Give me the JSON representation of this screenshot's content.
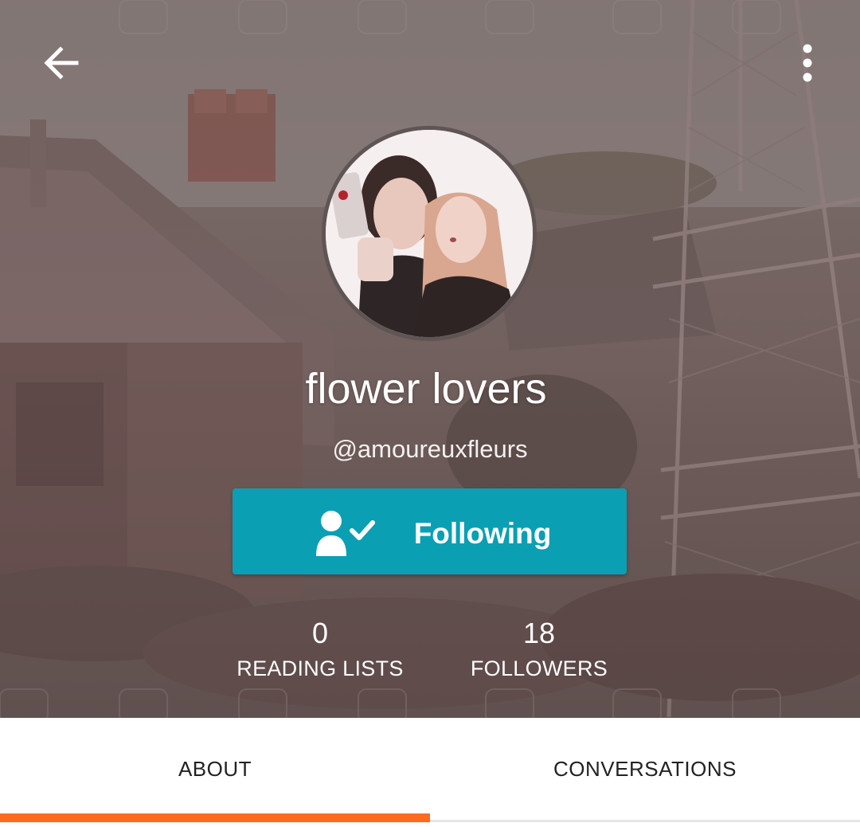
{
  "header": {
    "back_icon": "arrow-left-icon",
    "menu_icon": "more-vertical-icon"
  },
  "profile": {
    "name": "flower lovers",
    "handle": "@amoureuxfleurs",
    "avatar_icon": "profile-photo"
  },
  "follow": {
    "label": "Following",
    "icon": "user-check-icon",
    "color": "#0b9fb4"
  },
  "stats": [
    {
      "count": "0",
      "label": "READING LISTS"
    },
    {
      "count": "18",
      "label": "FOLLOWERS"
    }
  ],
  "tabs": [
    {
      "label": "ABOUT",
      "active": true
    },
    {
      "label": "CONVERSATIONS",
      "active": false
    }
  ],
  "colors": {
    "accent": "#ff6a22",
    "follow_button": "#0b9fb4"
  }
}
